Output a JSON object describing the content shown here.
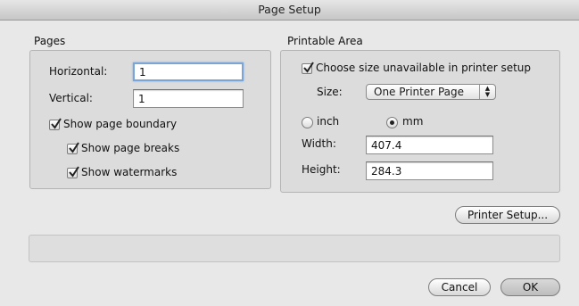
{
  "window": {
    "title": "Page Setup"
  },
  "pages": {
    "group_title": "Pages",
    "horizontal_label": "Horizontal:",
    "horizontal_value": "1",
    "vertical_label": "Vertical:",
    "vertical_value": "1",
    "show_page_boundary": {
      "label": "Show page boundary",
      "checked": true
    },
    "show_page_breaks": {
      "label": "Show page breaks",
      "checked": true
    },
    "show_watermarks": {
      "label": "Show watermarks",
      "checked": true
    }
  },
  "printable_area": {
    "group_title": "Printable Area",
    "choose_size": {
      "label": "Choose size unavailable in printer setup",
      "checked": true
    },
    "size_label": "Size:",
    "size_value": "One Printer Page",
    "unit_inch": {
      "label": "inch",
      "selected": false
    },
    "unit_mm": {
      "label": "mm",
      "selected": true
    },
    "width_label": "Width:",
    "width_value": "407.4",
    "height_label": "Height:",
    "height_value": "284.3"
  },
  "buttons": {
    "printer_setup": "Printer Setup...",
    "cancel": "Cancel",
    "ok": "OK"
  }
}
